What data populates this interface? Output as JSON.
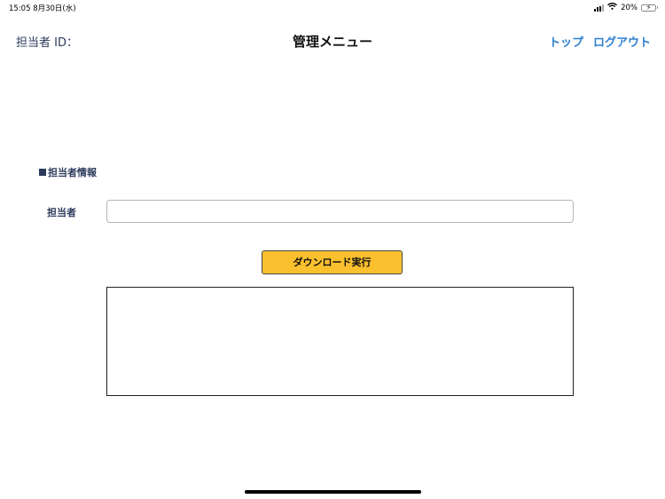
{
  "status_bar": {
    "time_date": "15:05   8月30日(水)",
    "battery_percent": "20%",
    "battery_level": 0.2,
    "icons": [
      "signal-icon",
      "wifi-icon",
      "battery-charging-icon"
    ]
  },
  "header": {
    "staff_id_label": "担当者 ID：",
    "title": "管理メニュー",
    "nav": {
      "top_label": "トップ",
      "logout_label": "ログアウト"
    }
  },
  "section": {
    "heading": "担当者情報",
    "staff_field": {
      "label": "担当者",
      "value": "",
      "placeholder": ""
    },
    "download_button_label": "ダウンロード実行",
    "output_text": ""
  },
  "colors": {
    "nav_link": "#2c7fd0",
    "label_text": "#2c3a5c",
    "button_bg": "#fbc02d",
    "battery_fill": "#34c759"
  }
}
